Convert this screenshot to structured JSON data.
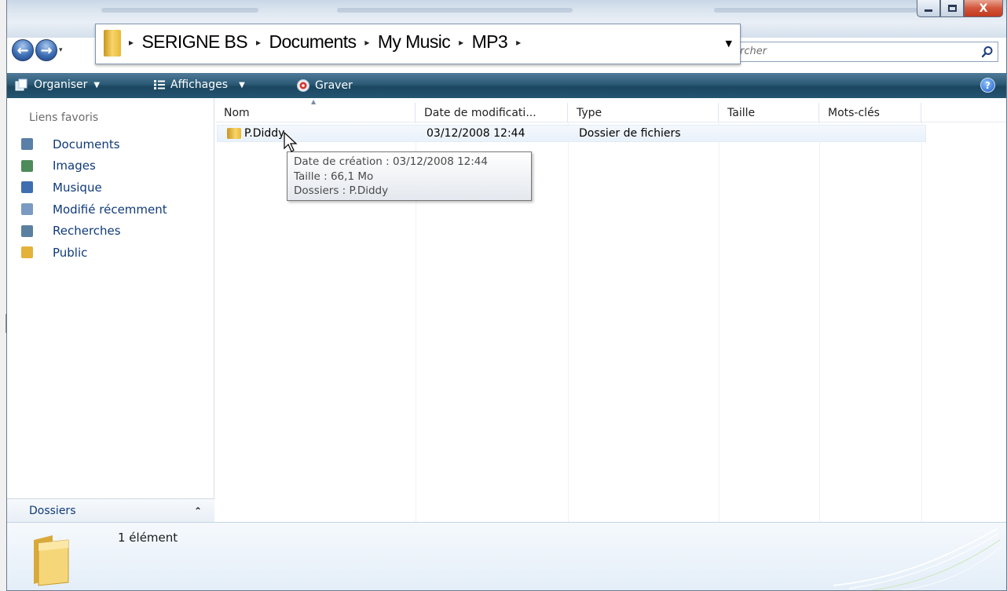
{
  "window": {
    "minimize_icon": "minimize-icon",
    "maximize_icon": "maximize-icon",
    "close_label": "X"
  },
  "navigation": {
    "back_icon": "back-arrow-icon",
    "forward_icon": "forward-arrow-icon",
    "back_glyph": "←",
    "forward_glyph": "→",
    "dropdown_glyph": "▾"
  },
  "address": {
    "breadcrumbs": [
      "SERIGNE BS",
      "Documents",
      "My Music",
      "MP3"
    ],
    "separator": "▸",
    "dropdown_glyph": "▼"
  },
  "search": {
    "placeholder": "rcher"
  },
  "commands": {
    "organiser": "Organiser",
    "affichages": "Affichages",
    "graver": "Graver",
    "caret": "▼",
    "help": "?"
  },
  "nav_pane": {
    "title": "Liens favoris",
    "items": [
      {
        "label": "Documents",
        "icon": "documents-icon",
        "color": "#5a7fa8"
      },
      {
        "label": "Images",
        "icon": "images-icon",
        "color": "#4f8a5b"
      },
      {
        "label": "Musique",
        "icon": "music-icon",
        "color": "#3f6fb0"
      },
      {
        "label": "Modifié récemment",
        "icon": "recent-icon",
        "color": "#7a9ac2"
      },
      {
        "label": "Recherches",
        "icon": "search-folder-icon",
        "color": "#5b7f9f"
      },
      {
        "label": "Public",
        "icon": "public-folder-icon",
        "color": "#e3b23a"
      }
    ],
    "folders_label": "Dossiers",
    "folders_chevron": "⌃"
  },
  "columns": [
    {
      "label": "Nom"
    },
    {
      "label": "Date de modificati..."
    },
    {
      "label": "Type"
    },
    {
      "label": "Taille"
    },
    {
      "label": "Mots-clés"
    }
  ],
  "sort_indicator": "▲",
  "files": [
    {
      "name": "P.Diddy",
      "modified": "03/12/2008 12:44",
      "type": "Dossier de fichiers",
      "size": "",
      "keywords": ""
    }
  ],
  "tooltip": {
    "created": "Date de création : 03/12/2008 12:44",
    "size": "Taille : 66,1 Mo",
    "folders": "Dossiers : P.Diddy"
  },
  "details": {
    "count": "1 élément"
  },
  "colors": {
    "command_bar": "#245571",
    "link_text": "#0f3a7a",
    "folder_yellow": "#f7d56b",
    "close_red": "#c13a1e"
  }
}
